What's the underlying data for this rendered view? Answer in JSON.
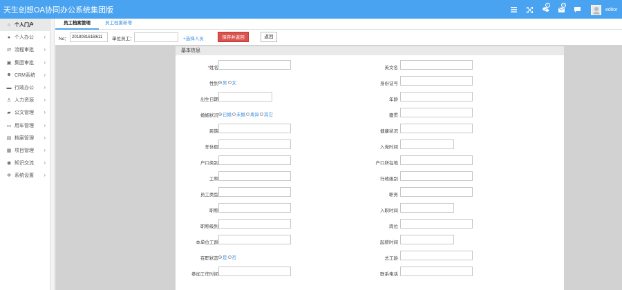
{
  "header": {
    "app_title": "天生创想OA协同办公系统集团版",
    "badge_chat": "7",
    "badge_mail": "0",
    "username": "editor",
    "icons": [
      "menu-icon",
      "fullscreen-icon",
      "chat-icon",
      "mail-icon",
      "message-icon"
    ]
  },
  "sidebar": {
    "items": [
      {
        "label": "个人门户",
        "icon": "home-icon",
        "active": true
      },
      {
        "label": "个人办公",
        "icon": "user-icon"
      },
      {
        "label": "流程审批",
        "icon": "workflow-icon"
      },
      {
        "label": "集团审批",
        "icon": "group-approval-icon"
      },
      {
        "label": "CRM系统",
        "icon": "users-icon"
      },
      {
        "label": "行政办公",
        "icon": "briefcase-icon"
      },
      {
        "label": "人力资源",
        "icon": "hr-icon"
      },
      {
        "label": "公文管理",
        "icon": "folder-icon"
      },
      {
        "label": "用车管理",
        "icon": "car-icon"
      },
      {
        "label": "档案管理",
        "icon": "archive-icon"
      },
      {
        "label": "项目管理",
        "icon": "project-icon"
      },
      {
        "label": "知识交流",
        "icon": "knowledge-icon"
      },
      {
        "label": "系统设置",
        "icon": "settings-icon"
      }
    ]
  },
  "tabs": [
    "员工档案管理",
    "员工档案新增"
  ],
  "toolbar": {
    "no_label": "No：",
    "no_value": "2018081616l611",
    "unit_label": "单位员工：",
    "unit_value": "",
    "select_link": "+选择人员",
    "save_label": "保存并返回",
    "back_label": "返回"
  },
  "form": {
    "section_title": "基本信息",
    "required_mark": "*",
    "rows": [
      {
        "left": "姓名",
        "left_required": true,
        "right": "英文名"
      },
      {
        "left": "性别",
        "left_radios": [
          {
            "label": "男",
            "checked": true
          },
          {
            "label": "女",
            "checked": false
          }
        ],
        "right": "身份证号"
      },
      {
        "left": "出生日期",
        "left_short": true,
        "right": "年龄"
      },
      {
        "left": "婚姻状况",
        "left_radios": [
          {
            "label": "已婚",
            "checked": true
          },
          {
            "label": "未婚",
            "checked": false
          },
          {
            "label": "离异",
            "checked": false
          },
          {
            "label": "其它",
            "checked": false
          }
        ],
        "right": "籍贯"
      },
      {
        "left": "民族",
        "right": "健康状况"
      },
      {
        "left": "年休假",
        "right": "入党时间",
        "right_short": true
      },
      {
        "left": "户口类别",
        "right": "户口所在地"
      },
      {
        "left": "工种",
        "right": "行政级别"
      },
      {
        "left": "员工类型",
        "right": "职务"
      },
      {
        "left": "职称",
        "right": "入职时间",
        "right_short": true
      },
      {
        "left": "职称级别",
        "right": "岗位"
      },
      {
        "left": "本单位工龄",
        "right": "起薪时间",
        "right_short": true
      },
      {
        "left": "在职状态",
        "left_radios": [
          {
            "label": "是",
            "checked": true
          },
          {
            "label": "否",
            "checked": false
          }
        ],
        "right": "总工龄"
      },
      {
        "left": "参加工作时间",
        "right": "联系电话"
      }
    ]
  }
}
